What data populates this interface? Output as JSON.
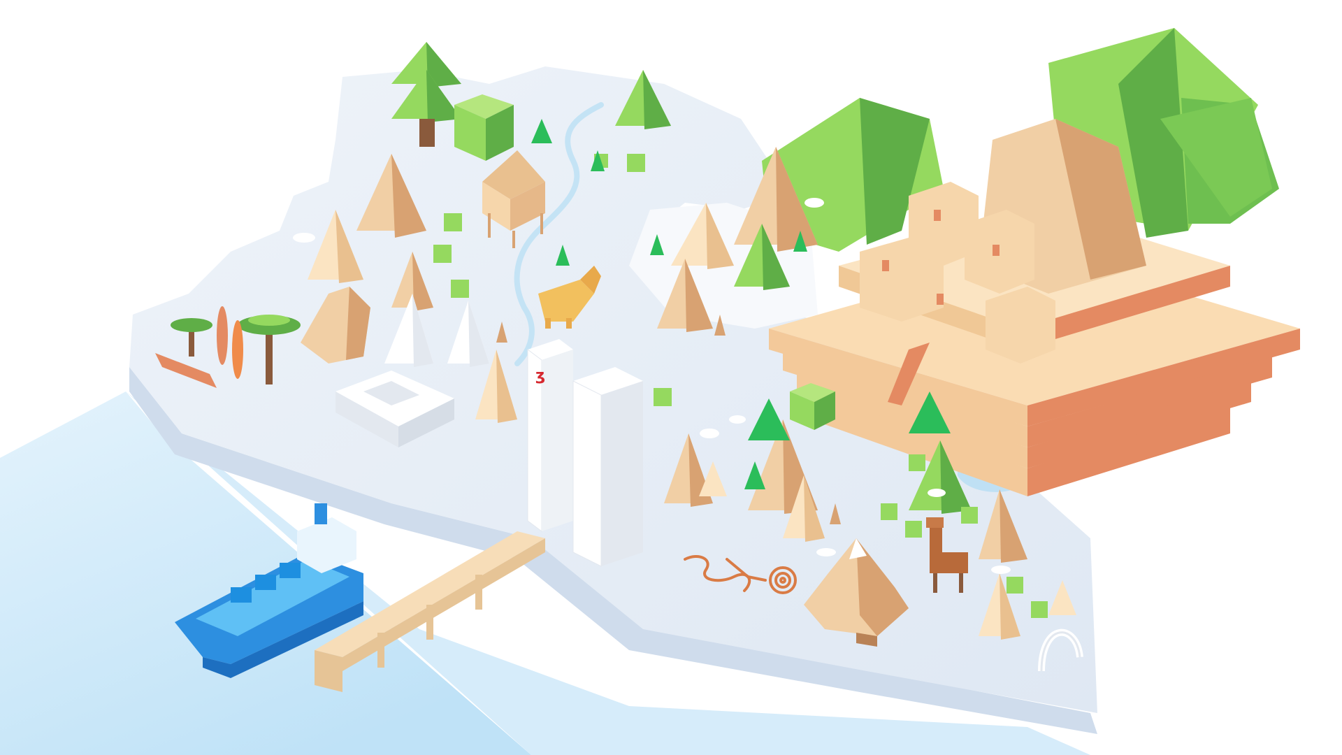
{
  "scene": {
    "type": "isometric-illustration",
    "logo_glyph": "ʒ",
    "colors": {
      "background": "#ffffff",
      "sea_light": "#dff0fb",
      "sea_mid": "#c6e6f8",
      "land_top": "#e9f0f8",
      "land_top_light": "#f3f6fb",
      "land_side": "#cfdcec",
      "river": "#bfe0f4",
      "tree_light": "#95d95f",
      "tree_dark": "#5fae47",
      "tree_bright": "#2bbd5a",
      "mountain_light": "#f1cfa5",
      "mountain_dark": "#d8a272",
      "pyramid_light": "#fbe4c2",
      "pyramid_dark": "#e9c08f",
      "brick_top": "#fadcb3",
      "brick_side": "#e48a62",
      "trunk": "#8a5a3c",
      "ship_hull": "#2d8fe0",
      "ship_hull_dark": "#1d6fc0",
      "ship_deck": "#5fc0f5",
      "tower_white": "#ffffff",
      "tower_shade": "#e3e8ef",
      "logo_red": "#d6282f",
      "pier": "#f7ddb8",
      "pier_side": "#e6c496",
      "nazca": "#d97b45",
      "llama": "#b86a3a",
      "jaguar": "#f2c05e",
      "arch": "#ffffff"
    },
    "icons": [
      "cargo-ship-icon",
      "twin-towers-icon",
      "pyramid-fortress-icon",
      "llama-icon",
      "jaguar-icon",
      "nazca-monkey-icon",
      "snow-mountain-icon",
      "stilt-house-icon",
      "palm-tree-icon",
      "surfboard-icon",
      "pier-icon",
      "white-temple-icon",
      "stone-arch-icon"
    ]
  }
}
